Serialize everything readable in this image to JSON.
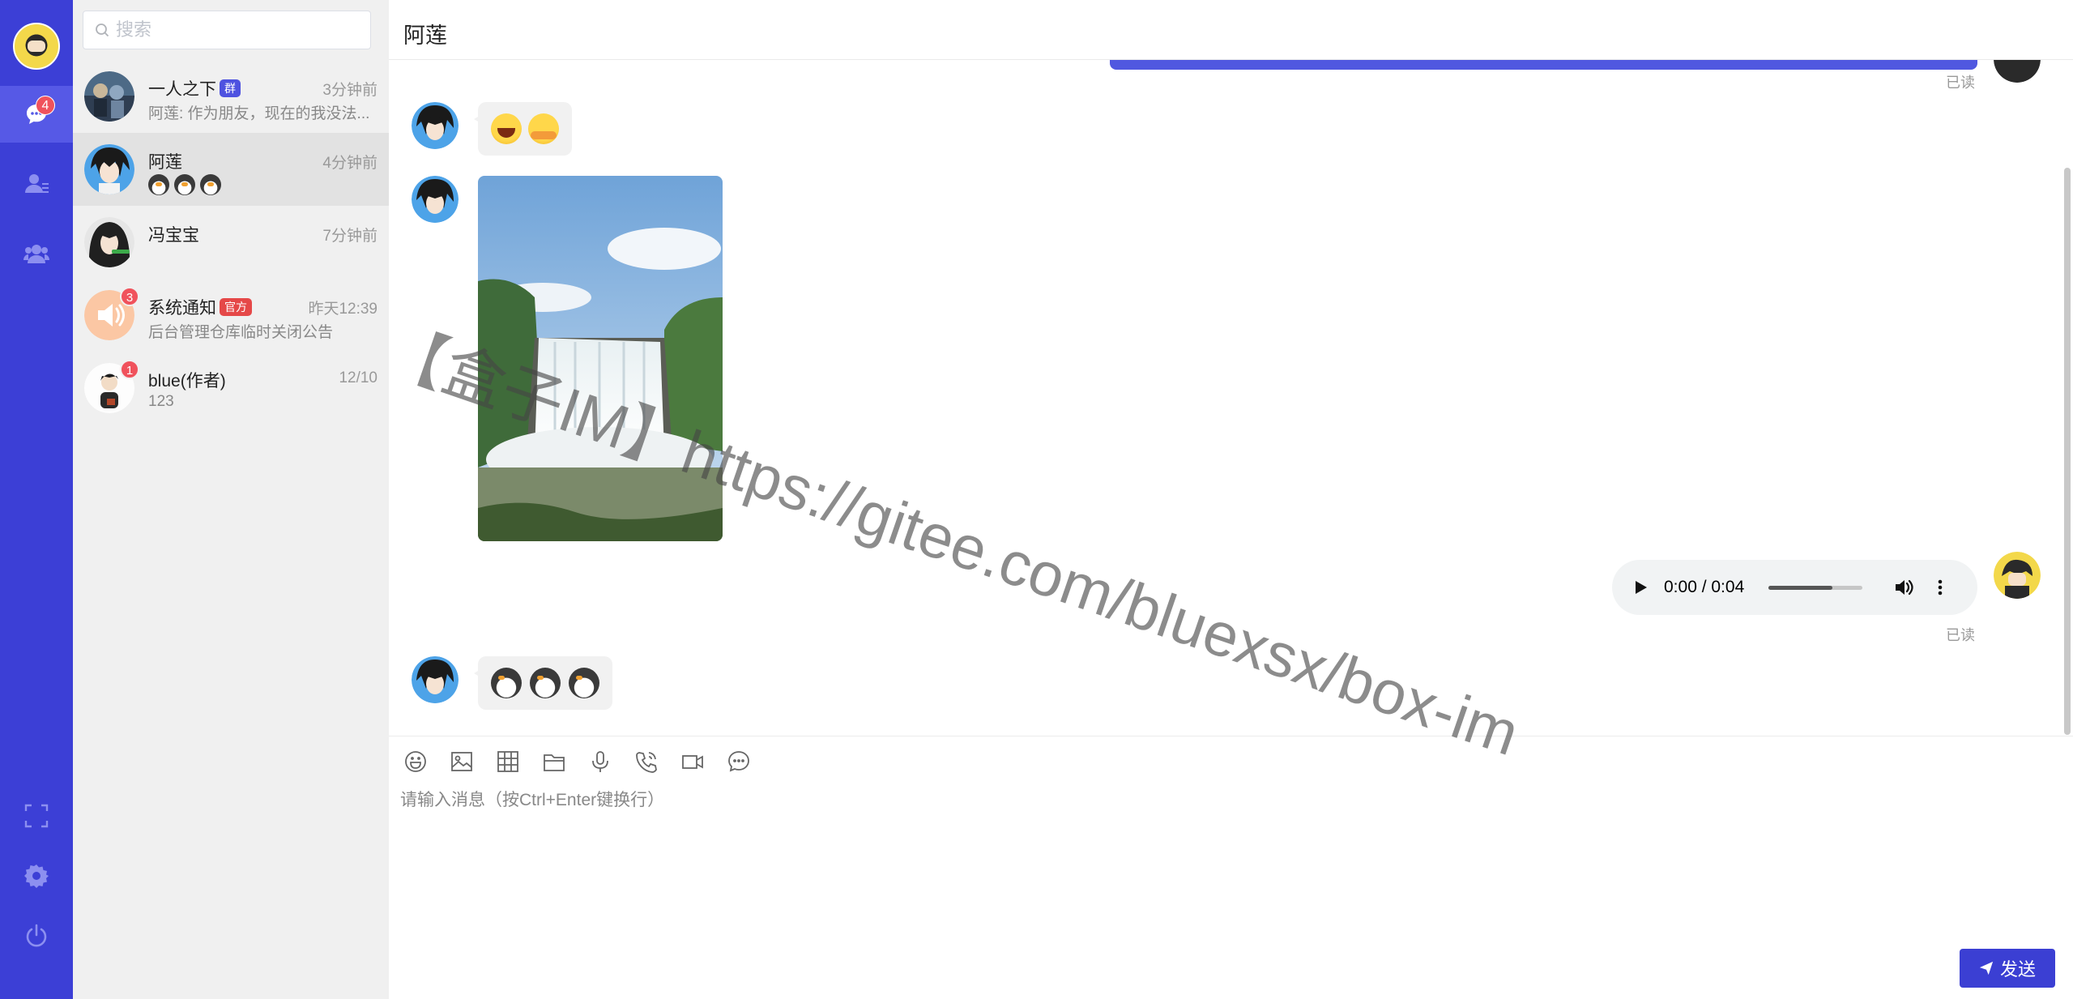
{
  "nav": {
    "message_badge": "4",
    "items": [
      {
        "name": "chat-icon"
      },
      {
        "name": "friends-icon"
      },
      {
        "name": "group-icon"
      },
      {
        "name": "fullscreen-icon"
      },
      {
        "name": "gear-icon"
      },
      {
        "name": "power-icon"
      }
    ]
  },
  "search": {
    "placeholder": "搜索"
  },
  "conversations": [
    {
      "name": "一人之下",
      "tag": "群",
      "time": "3分钟前",
      "preview": "阿莲: 作为朋友，现在的我没法..."
    },
    {
      "name": "阿莲",
      "time": "4分钟前",
      "preview_emojis": [
        "penguin-emoji",
        "penguin-emoji",
        "penguin-emoji"
      ]
    },
    {
      "name": "冯宝宝",
      "time": "7分钟前"
    },
    {
      "name": "系统通知",
      "tag": "官方",
      "time": "昨天12:39",
      "preview": "后台管理仓库临时关闭公告",
      "badge": "3"
    },
    {
      "name": "blue(作者)",
      "time": "12/10",
      "preview": "123",
      "badge": "1"
    }
  ],
  "chat": {
    "title": "阿莲",
    "read_label": "已读",
    "emoji_message": [
      "laugh-emoji",
      "hug-emoji"
    ],
    "audio": {
      "time": "0:00 / 0:04",
      "progress": 0.68
    },
    "penguin_message": [
      "penguin-emoji",
      "penguin-emoji",
      "penguin-emoji"
    ]
  },
  "composer": {
    "placeholder": "请输入消息（按Ctrl+Enter键换行）",
    "send_label": "发送",
    "tools": [
      "emoji-icon",
      "image-icon",
      "file-grid-icon",
      "folder-icon",
      "microphone-icon",
      "phone-icon",
      "video-icon",
      "chat-bubble-icon"
    ]
  },
  "watermark": "【盒子IM】https://gitee.com/bluexsx/box-im",
  "colors": {
    "nav_bg": "#3c3fd6",
    "send_btn": "#3b3fd3",
    "badge": "#f0525c",
    "group_tag": "#4e52e0",
    "official_tag": "#e54848"
  }
}
